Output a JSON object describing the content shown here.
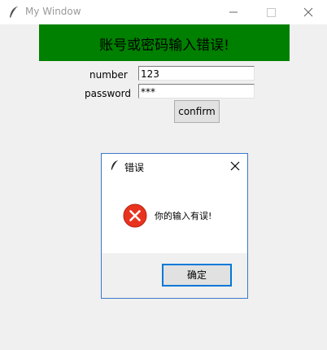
{
  "window": {
    "title": "My Window",
    "banner_text": "账号或密码输入错误!",
    "number_label": "number",
    "number_value": "123",
    "password_label": "password",
    "password_value": "***",
    "confirm_label": "confirm"
  },
  "dialog": {
    "title": "错误",
    "message": "你的输入有误!",
    "ok_label": "确定",
    "icon": "error-icon"
  },
  "colors": {
    "banner": "#008000",
    "error_icon": "#e8331e",
    "dialog_border": "#3a78c9"
  }
}
